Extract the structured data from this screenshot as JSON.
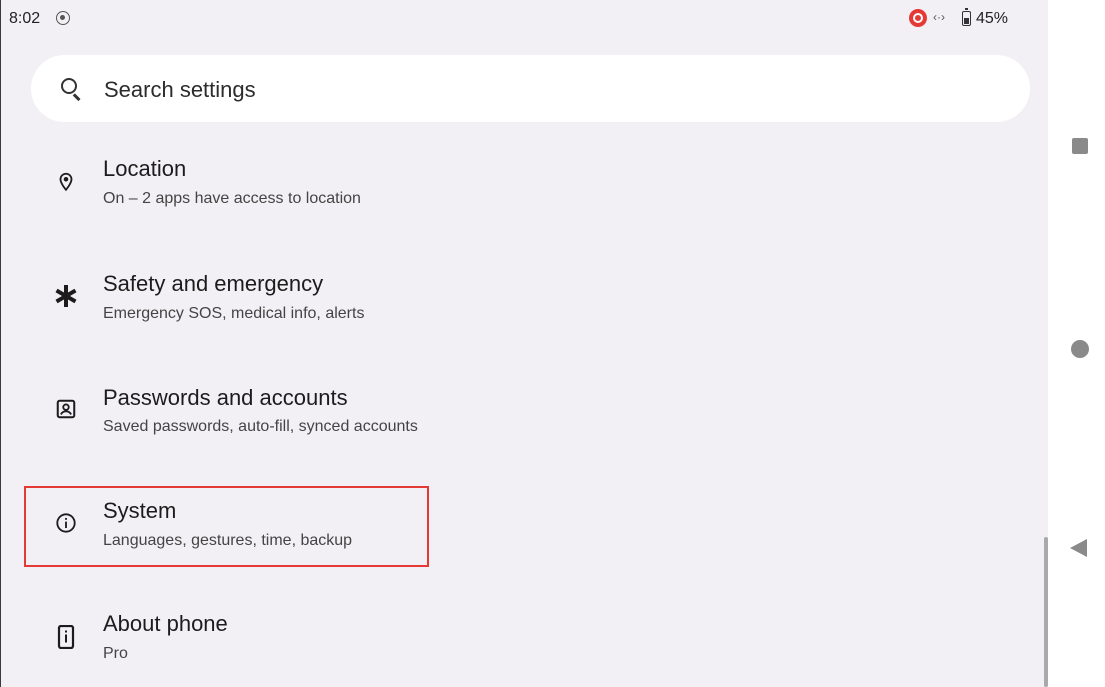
{
  "status_bar": {
    "time": "8:02",
    "battery": "45%",
    "icons": [
      "screen-record-icon",
      "cast-icon",
      "data-transfer-icon",
      "battery-icon"
    ],
    "data_glyph": "‹·›"
  },
  "search": {
    "label": "Search settings",
    "icon": "search-icon"
  },
  "settings_items": [
    {
      "icon": "location-pin-icon",
      "title": "Location",
      "subtitle": "On – 2 apps have access to location"
    },
    {
      "icon": "asterisk-icon",
      "title": "Safety and emergency",
      "subtitle": "Emergency SOS, medical info, alerts"
    },
    {
      "icon": "account-box-icon",
      "title": "Passwords and accounts",
      "subtitle": "Saved passwords, auto-fill, synced accounts"
    },
    {
      "icon": "info-icon",
      "title": "System",
      "subtitle": "Languages, gestures, time, backup",
      "highlighted": true
    },
    {
      "icon": "phone-info-icon",
      "title": "About phone",
      "subtitle": "Pro"
    }
  ],
  "nav_bar": {
    "buttons": [
      "recents-button",
      "home-button",
      "back-button"
    ]
  },
  "colors": {
    "background": "#f2f0f4",
    "surface": "#ffffff",
    "highlight": "#e53935",
    "text_primary": "#1c1c1c",
    "text_secondary": "#444444"
  }
}
